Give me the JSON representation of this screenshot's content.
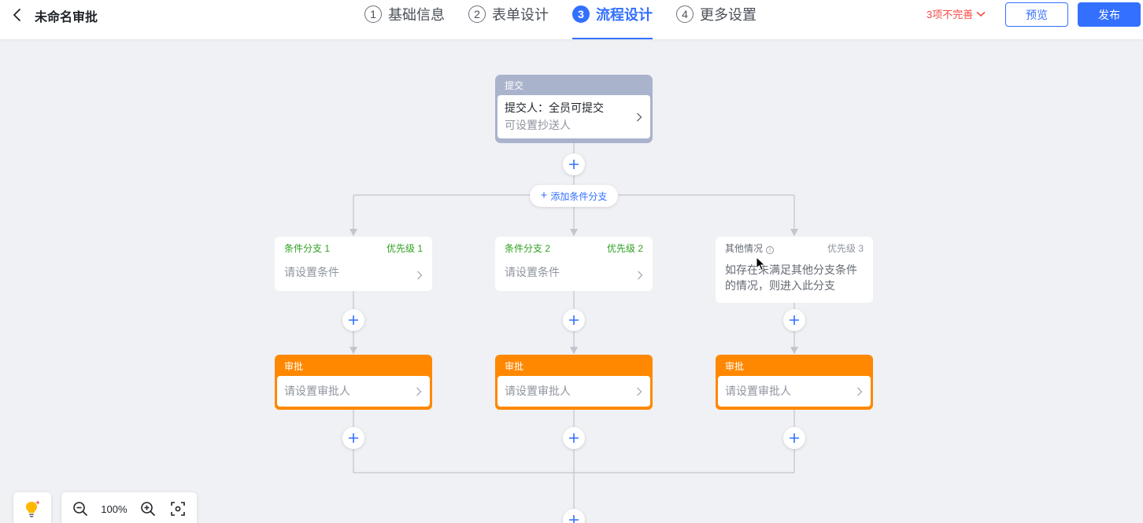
{
  "header": {
    "title": "未命名审批",
    "steps": [
      {
        "num": "1",
        "label": "基础信息"
      },
      {
        "num": "2",
        "label": "表单设计"
      },
      {
        "num": "3",
        "label": "流程设计"
      },
      {
        "num": "4",
        "label": "更多设置"
      }
    ],
    "active_step": 3,
    "warning": "3项不完善",
    "preview_label": "预览",
    "publish_label": "发布"
  },
  "colors": {
    "accent": "#3370ff",
    "submit_node": "#aab3cc",
    "approve_node": "#ff8800",
    "condition_text": "#2ea121",
    "warning": "#f54a45"
  },
  "flow": {
    "submit": {
      "title": "提交",
      "submitter": "提交人：全员可提交",
      "cc_hint": "可设置抄送人"
    },
    "add_branch_label": "添加条件分支",
    "branches": [
      {
        "name": "条件分支 1",
        "priority": "优先级 1",
        "condition": "请设置条件",
        "approver_title": "审批",
        "approver_hint": "请设置审批人"
      },
      {
        "name": "条件分支 2",
        "priority": "优先级 2",
        "condition": "请设置条件",
        "approver_title": "审批",
        "approver_hint": "请设置审批人"
      },
      {
        "name": "其他情况",
        "priority": "优先级 3",
        "condition": "如存在未满足其他分支条件的情况，则进入此分支",
        "approver_title": "审批",
        "approver_hint": "请设置审批人"
      }
    ]
  },
  "toolbar": {
    "zoom": "100%",
    "icons": [
      "lightbulb-icon",
      "zoom-out-icon",
      "zoom-in-icon",
      "fit-screen-icon"
    ]
  }
}
